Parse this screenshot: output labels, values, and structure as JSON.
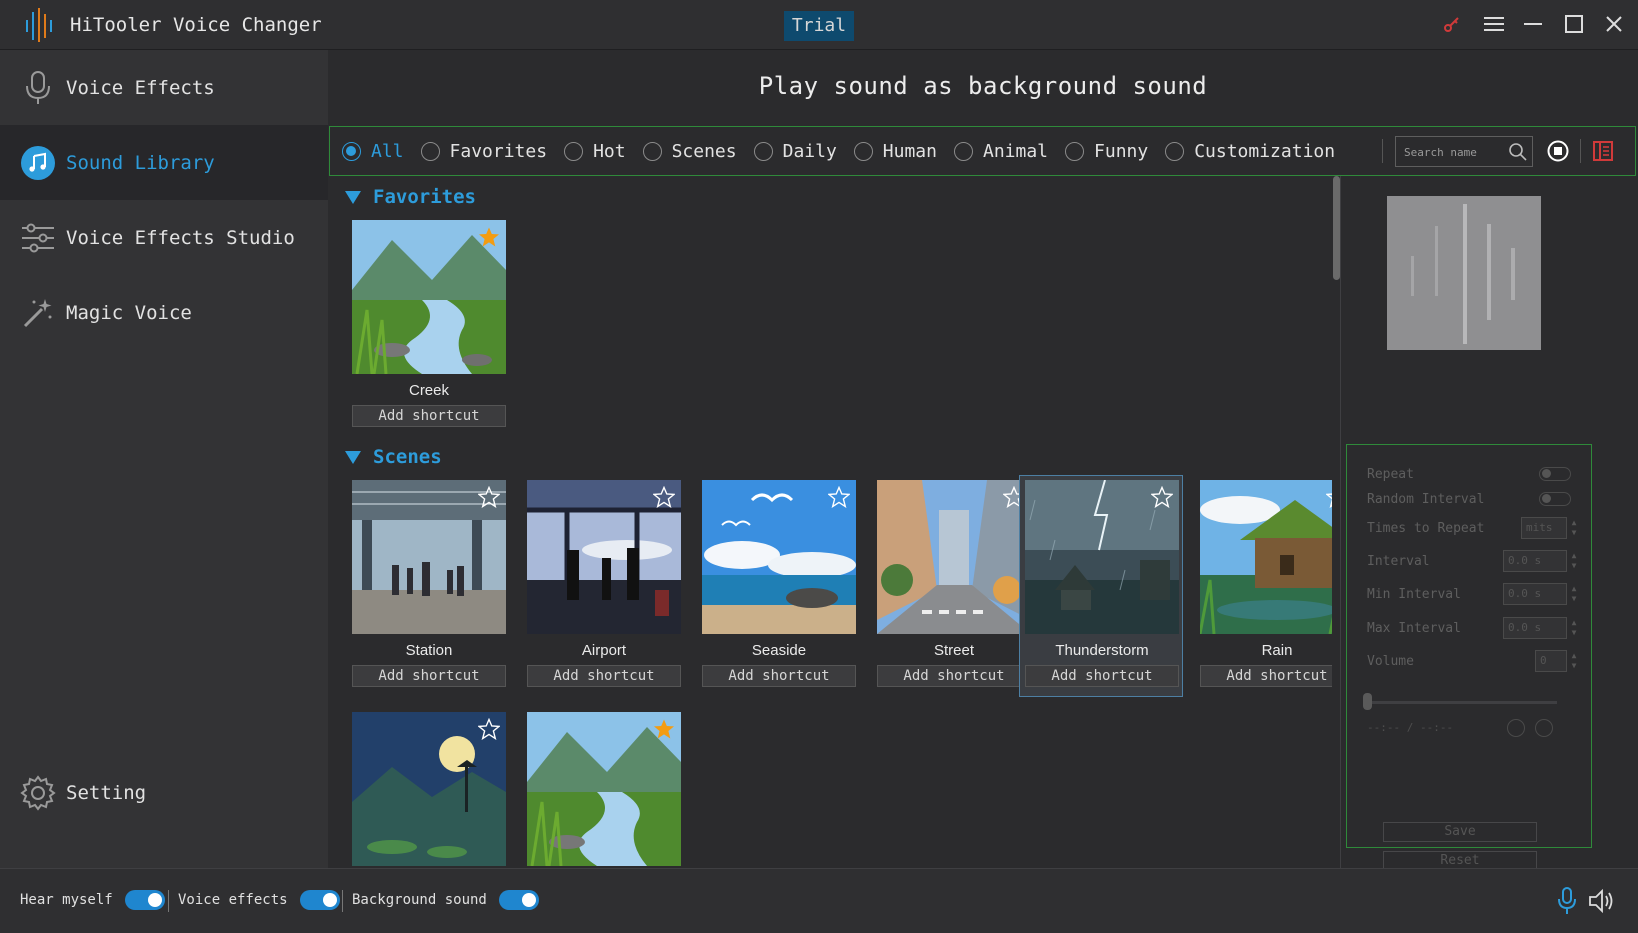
{
  "app": {
    "title": "HiTooler Voice Changer",
    "trial_label": "Trial"
  },
  "sidebar": {
    "items": [
      {
        "label": "Voice Effects",
        "icon": "microphone-icon"
      },
      {
        "label": "Sound Library",
        "icon": "music-note-icon"
      },
      {
        "label": "Voice Effects Studio",
        "icon": "sliders-icon"
      },
      {
        "label": "Magic Voice",
        "icon": "magic-wand-icon"
      }
    ],
    "active": "Sound Library",
    "setting_label": "Setting"
  },
  "main": {
    "title": "Play sound as background sound",
    "filters": [
      "All",
      "Favorites",
      "Hot",
      "Scenes",
      "Daily",
      "Human",
      "Animal",
      "Funny",
      "Customization"
    ],
    "selected_filter": "All",
    "search_placeholder": "Search name"
  },
  "sections": [
    {
      "title": "Favorites",
      "items": [
        {
          "name": "Creek",
          "shortcut_label": "Add shortcut",
          "favorite": true
        }
      ]
    },
    {
      "title": "Scenes",
      "items": [
        {
          "name": "Station",
          "shortcut_label": "Add shortcut",
          "favorite": false
        },
        {
          "name": "Airport",
          "shortcut_label": "Add shortcut",
          "favorite": false
        },
        {
          "name": "Seaside",
          "shortcut_label": "Add shortcut",
          "favorite": false
        },
        {
          "name": "Street",
          "shortcut_label": "Add shortcut",
          "favorite": false
        },
        {
          "name": "Thunderstorm",
          "shortcut_label": "Add shortcut",
          "favorite": false
        },
        {
          "name": "Rain",
          "shortcut_label": "Add shortcut",
          "favorite": false
        },
        {
          "name": "",
          "shortcut_label": "",
          "favorite": false
        },
        {
          "name": "",
          "shortcut_label": "",
          "favorite": true
        }
      ]
    }
  ],
  "settings": {
    "repeat_label": "Repeat",
    "random_interval_label": "Random Interval",
    "times_to_repeat_label": "Times to Repeat",
    "times_to_repeat_value": "mits",
    "interval_label": "Interval",
    "interval_value": "0.0 s",
    "min_interval_label": "Min Interval",
    "min_interval_value": "0.0 s",
    "max_interval_label": "Max Interval",
    "max_interval_value": "0.0 s",
    "volume_label": "Volume",
    "volume_value": "0",
    "time_display": "--:-- / --:--",
    "save_label": "Save",
    "reset_label": "Reset"
  },
  "bottom": {
    "hear_myself_label": "Hear myself",
    "voice_effects_label": "Voice effects",
    "background_sound_label": "Background sound",
    "hear_myself_on": true,
    "voice_effects_on": true,
    "background_sound_on": true
  },
  "colors": {
    "accent": "#2d9cdb",
    "frame_green": "#2f8a3a",
    "star_orange": "#f39c12",
    "toggle_blue": "#1f86cf"
  }
}
